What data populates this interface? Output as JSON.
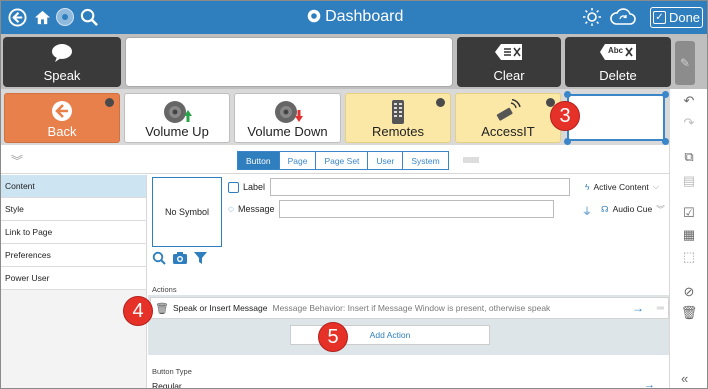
{
  "topbar": {
    "title": "Dashboard",
    "done_label": "Done",
    "icons": [
      "back-icon",
      "home-icon",
      "settings-icon",
      "search-icon",
      "brightness-icon",
      "cloud-sync-icon"
    ]
  },
  "message_bar": {
    "speak_label": "Speak",
    "clear_label": "Clear",
    "delete_label": "Delete",
    "delete_icon_text": "Abc"
  },
  "button_row": {
    "buttons": [
      {
        "label": "Back"
      },
      {
        "label": "Volume Up"
      },
      {
        "label": "Volume Down"
      },
      {
        "label": "Remotes"
      },
      {
        "label": "AccessIT"
      }
    ]
  },
  "tabs": [
    {
      "label": "Button",
      "active": true
    },
    {
      "label": "Page"
    },
    {
      "label": "Page Set"
    },
    {
      "label": "User"
    },
    {
      "label": "System"
    }
  ],
  "sidebar": {
    "items": [
      {
        "label": "Content",
        "active": true
      },
      {
        "label": "Style"
      },
      {
        "label": "Link to Page"
      },
      {
        "label": "Preferences"
      },
      {
        "label": "Power User"
      }
    ]
  },
  "editor": {
    "no_symbol": "No Symbol",
    "label_field_label": "Label",
    "message_field_label": "Message",
    "active_content": "Active Content",
    "audio_cue": "Audio Cue",
    "actions_label": "Actions",
    "action_title": "Speak or Insert Message",
    "action_desc": "Message Behavior: Insert if Message Window is present, otherwise speak",
    "add_action_label": "Add Action",
    "button_type_label": "Button Type",
    "button_type_value": "Regular"
  },
  "badges": [
    "3",
    "4",
    "5"
  ],
  "colors": {
    "topbar": "#2f7ebd",
    "back_button": "#e8804c",
    "yellow_button": "#fbe8a6",
    "badge": "#e63129"
  }
}
